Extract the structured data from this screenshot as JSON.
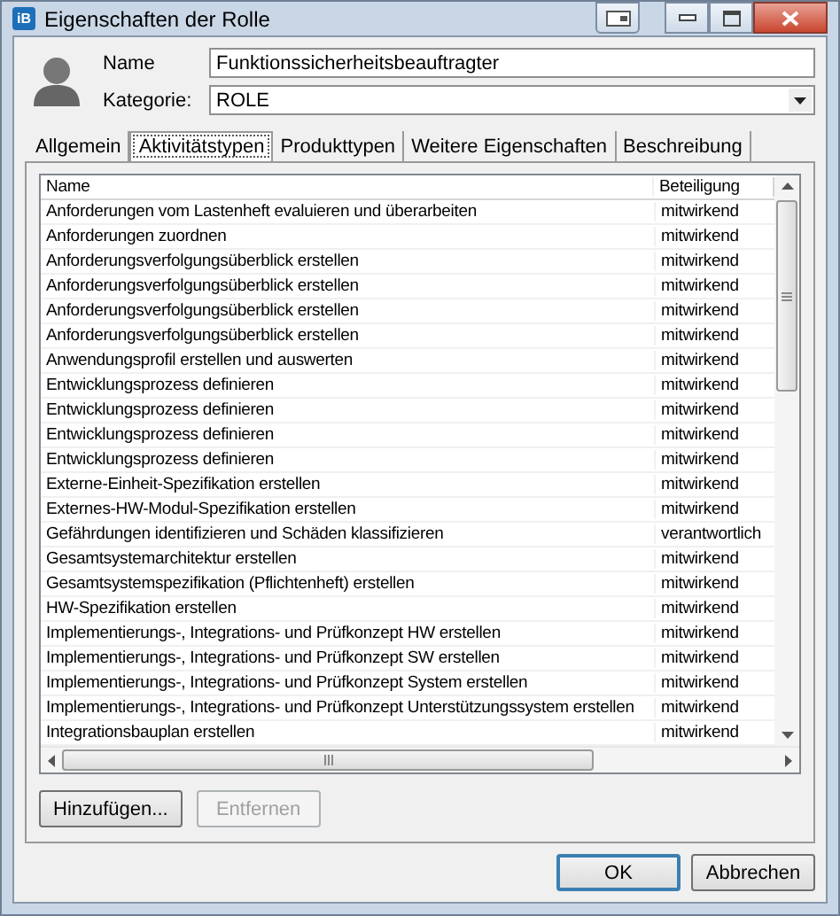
{
  "window": {
    "title": "Eigenschaften der Rolle",
    "icon_text": "iB"
  },
  "fields": [
    {
      "label": "Name",
      "value": "Funktionssicherheitsbeauftragter",
      "kind": "text"
    },
    {
      "label": "Kategorie:",
      "value": "ROLE",
      "kind": "dropdown"
    }
  ],
  "tabs": [
    {
      "label": "Allgemein",
      "selected": false
    },
    {
      "label": "Aktivitätstypen",
      "selected": true
    },
    {
      "label": "Produkttypen",
      "selected": false
    },
    {
      "label": "Weitere Eigenschaften",
      "selected": false
    },
    {
      "label": "Beschreibung",
      "selected": false
    }
  ],
  "table": {
    "columns": [
      "Name",
      "Beteiligung"
    ],
    "rows": [
      [
        "Anforderungen vom Lastenheft evaluieren und überarbeiten",
        "mitwirkend"
      ],
      [
        "Anforderungen zuordnen",
        "mitwirkend"
      ],
      [
        "Anforderungsverfolgungsüberblick erstellen",
        "mitwirkend"
      ],
      [
        "Anforderungsverfolgungsüberblick erstellen",
        "mitwirkend"
      ],
      [
        "Anforderungsverfolgungsüberblick erstellen",
        "mitwirkend"
      ],
      [
        "Anforderungsverfolgungsüberblick erstellen",
        "mitwirkend"
      ],
      [
        "Anwendungsprofil erstellen und auswerten",
        "mitwirkend"
      ],
      [
        "Entwicklungsprozess definieren",
        "mitwirkend"
      ],
      [
        "Entwicklungsprozess definieren",
        "mitwirkend"
      ],
      [
        "Entwicklungsprozess definieren",
        "mitwirkend"
      ],
      [
        "Entwicklungsprozess definieren",
        "mitwirkend"
      ],
      [
        "Externe-Einheit-Spezifikation erstellen",
        "mitwirkend"
      ],
      [
        "Externes-HW-Modul-Spezifikation erstellen",
        "mitwirkend"
      ],
      [
        "Gefährdungen identifizieren und Schäden klassifizieren",
        "verantwortlich"
      ],
      [
        "Gesamtsystemarchitektur erstellen",
        "mitwirkend"
      ],
      [
        "Gesamtsystemspezifikation (Pflichtenheft) erstellen",
        "mitwirkend"
      ],
      [
        "HW-Spezifikation erstellen",
        "mitwirkend"
      ],
      [
        "Implementierungs-, Integrations- und Prüfkonzept HW erstellen",
        "mitwirkend"
      ],
      [
        "Implementierungs-, Integrations- und Prüfkonzept SW erstellen",
        "mitwirkend"
      ],
      [
        "Implementierungs-, Integrations- und Prüfkonzept System erstellen",
        "mitwirkend"
      ],
      [
        "Implementierungs-, Integrations- und Prüfkonzept Unterstützungssystem erstellen",
        "mitwirkend"
      ],
      [
        "Integrationsbauplan erstellen",
        "mitwirkend"
      ]
    ]
  },
  "buttons": [
    {
      "label": "Hinzufügen...",
      "disabled": false
    },
    {
      "label": "Entfernen",
      "disabled": true
    }
  ],
  "footer_buttons": [
    {
      "label": "OK",
      "default": true
    },
    {
      "label": "Abbrechen",
      "default": false
    }
  ]
}
